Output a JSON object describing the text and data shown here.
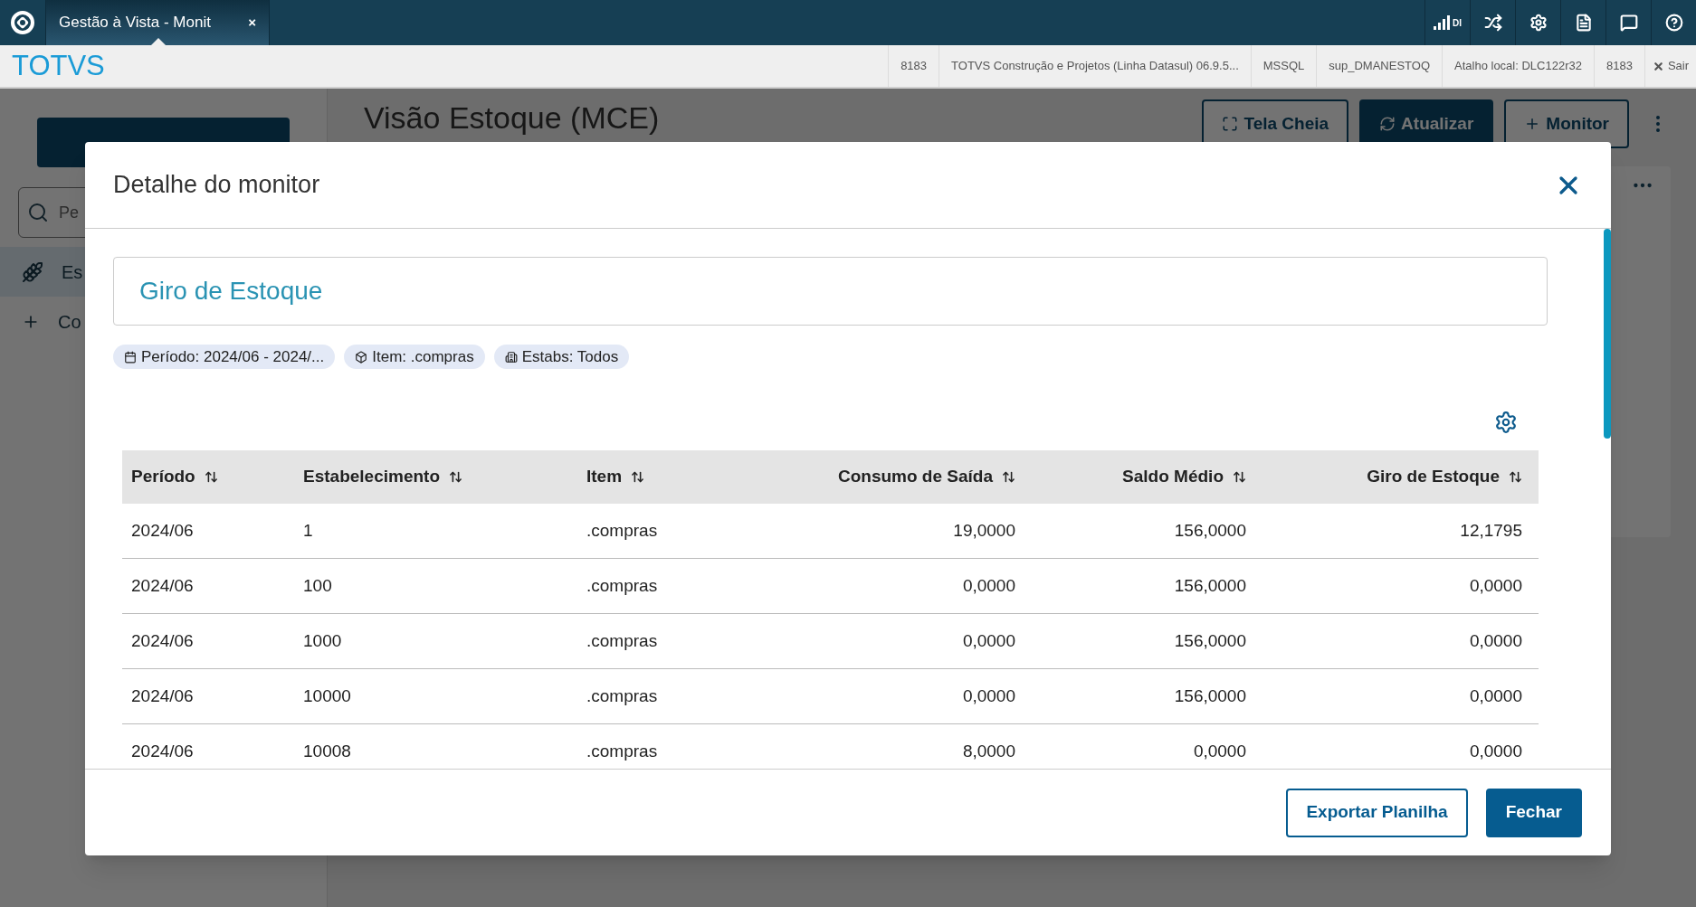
{
  "top_bar": {
    "tab": {
      "title": "Gestão à Vista - Monit",
      "close": "×",
      "selected": true
    },
    "signal_label": "DI"
  },
  "header": {
    "brand": "TOTVS",
    "info": [
      "8183",
      "TOTVS Construção e Projetos (Linha Datasul) 06.9.5...",
      "MSSQL",
      "sup_DMANESTOQ",
      "Atalho local: DLC122r32",
      "8183"
    ],
    "logout": "Sair"
  },
  "background": {
    "sidebar": {
      "search": {
        "placeholder": "Pe"
      },
      "items": [
        {
          "label": "Es",
          "kind": "wheat",
          "selected": true
        },
        {
          "label": "Co",
          "kind": "plus",
          "selected": false
        }
      ]
    },
    "title": "Visão Estoque (MCE)",
    "actions": [
      {
        "label": "Tela Cheia",
        "kind": "fullscreen"
      },
      {
        "label": "Atualizar",
        "kind": "refresh"
      },
      {
        "label": "Monitor",
        "kind": "add"
      }
    ]
  },
  "modal": {
    "title": "Detalhe do monitor",
    "monitor_name": "Giro de Estoque",
    "chips": [
      {
        "kind": "calendar",
        "label": "Período: 2024/06 - 2024/..."
      },
      {
        "kind": "box",
        "label": "Item: .compras"
      },
      {
        "kind": "building",
        "label": "Estabs: Todos"
      }
    ],
    "table": {
      "columns": [
        "Período",
        "Estabelecimento",
        "Item",
        "Consumo de Saída",
        "Saldo Médio",
        "Giro de Estoque"
      ],
      "rows": [
        [
          "2024/06",
          "1",
          ".compras",
          "19,0000",
          "156,0000",
          "12,1795"
        ],
        [
          "2024/06",
          "100",
          ".compras",
          "0,0000",
          "156,0000",
          "0,0000"
        ],
        [
          "2024/06",
          "1000",
          ".compras",
          "0,0000",
          "156,0000",
          "0,0000"
        ],
        [
          "2024/06",
          "10000",
          ".compras",
          "0,0000",
          "156,0000",
          "0,0000"
        ],
        [
          "2024/06",
          "10008",
          ".compras",
          "8,0000",
          "0,0000",
          "0,0000"
        ]
      ]
    },
    "buttons": [
      {
        "label": "Exportar Planilha",
        "kind": "secondary"
      },
      {
        "label": "Fechar",
        "kind": "primary"
      }
    ]
  }
}
